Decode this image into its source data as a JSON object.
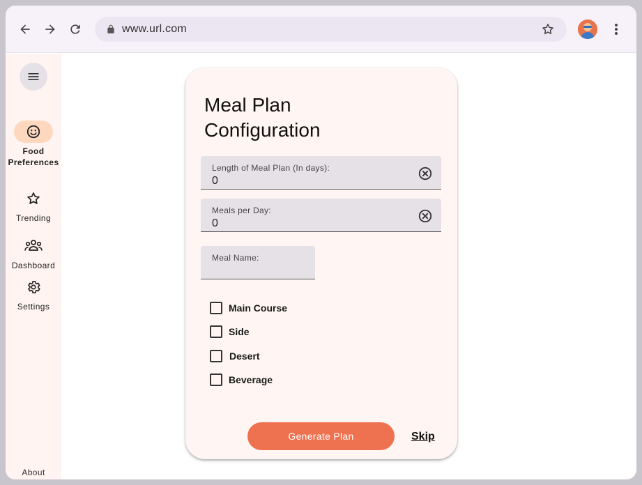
{
  "browser": {
    "url": "www.url.com",
    "icons": [
      "back-arrow-icon",
      "forward-arrow-icon",
      "reload-icon",
      "lock-icon",
      "star-icon",
      "avatar",
      "more-vert-icon"
    ]
  },
  "rail": {
    "items": [
      {
        "label_line1": "Food",
        "label_line2": "Preferences",
        "icon": "smiley-icon",
        "active": true
      },
      {
        "label": "Trending",
        "icon": "star-icon"
      },
      {
        "label": "Dashboard",
        "icon": "group-icon"
      },
      {
        "label": "Settings",
        "icon": "gear-icon"
      }
    ],
    "about": "About"
  },
  "card": {
    "title": "Meal Plan Configuration",
    "fields": [
      {
        "label": "Length of Meal Plan (In days):",
        "value": "0"
      },
      {
        "label": "Meals per Day:",
        "value": "0"
      },
      {
        "label": "Meal Name:",
        "value": ""
      }
    ],
    "checkboxes": [
      {
        "label": "Main Course",
        "checked": false
      },
      {
        "label": "Side",
        "checked": false
      },
      {
        "label": "Desert",
        "checked": false
      },
      {
        "label": "Beverage",
        "checked": false
      }
    ],
    "generate_label": "Generate Plan",
    "skip_label": "Skip"
  },
  "colors": {
    "accent": "#ef7250",
    "rail_active": "#fdd8bf",
    "card_bg": "#fff5f2",
    "field_bg": "#e6e0e7"
  }
}
